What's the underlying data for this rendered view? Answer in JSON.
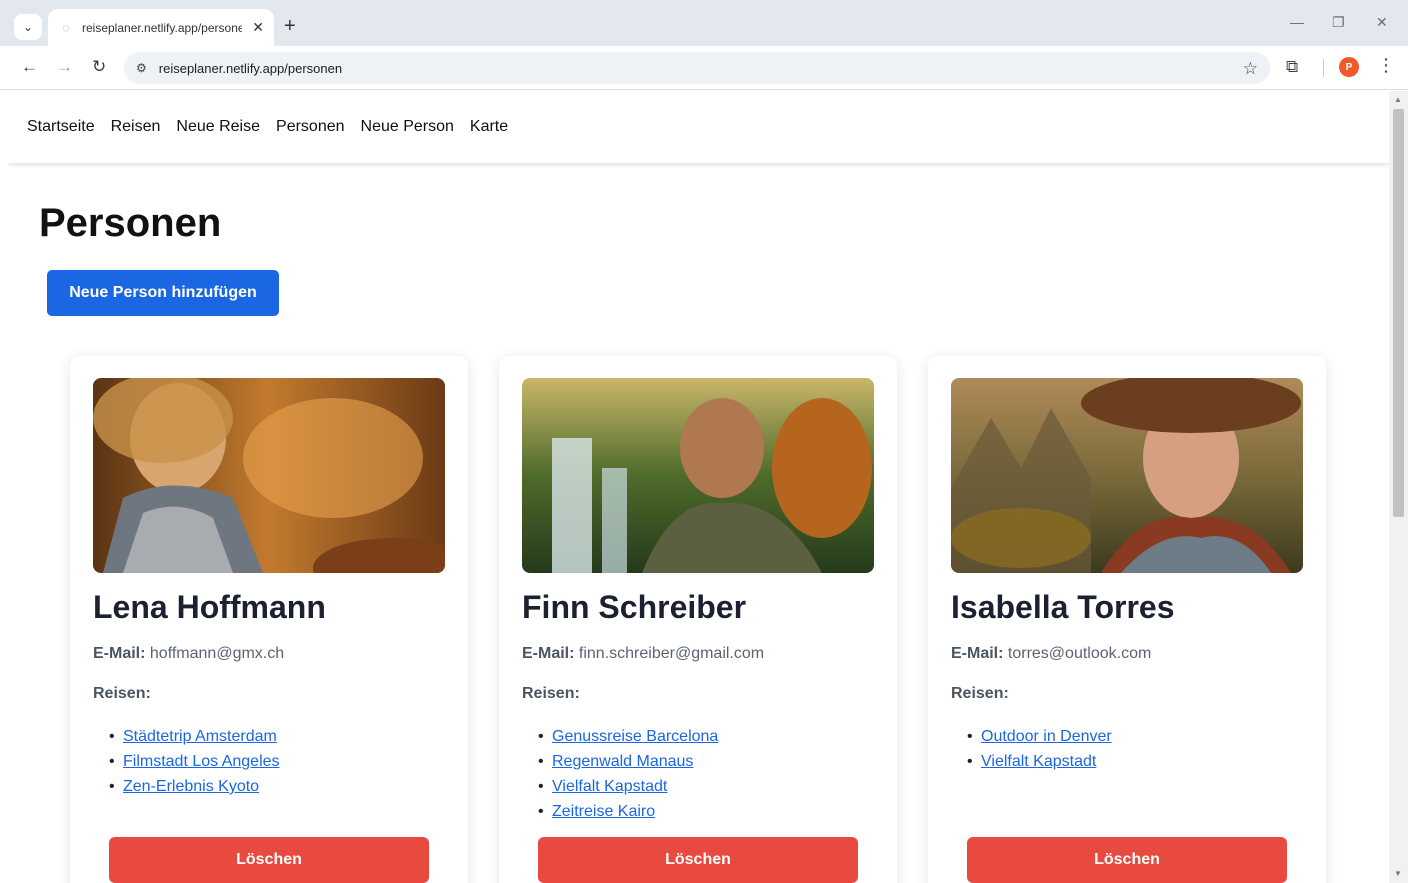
{
  "browser": {
    "tab_title": "reiseplaner.netlify.app/persone",
    "url": "reiseplaner.netlify.app/personen",
    "profile_initial": "P",
    "icons": {
      "tab_menu": "chevron-down-icon",
      "favicon": "globe-icon",
      "close": "close-icon",
      "new_tab": "plus-icon",
      "back": "back-arrow-icon",
      "forward": "forward-arrow-icon",
      "reload": "reload-icon",
      "site_info": "tune-icon",
      "bookmark": "star-icon",
      "extensions": "puzzle-icon",
      "menu": "kebab-menu-icon"
    }
  },
  "nav": {
    "items": [
      "Startseite",
      "Reisen",
      "Neue Reise",
      "Personen",
      "Neue Person",
      "Karte"
    ]
  },
  "page": {
    "title": "Personen",
    "add_button": "Neue Person hinzufügen"
  },
  "labels": {
    "email": "E-Mail:",
    "trips": "Reisen:",
    "delete": "Löschen"
  },
  "persons": [
    {
      "name": "Lena Hoffmann",
      "email": "hoffmann@gmx.ch",
      "trips": [
        "Städtetrip Amsterdam",
        "Filmstadt Los Angeles",
        "Zen-Erlebnis Kyoto"
      ]
    },
    {
      "name": "Finn Schreiber",
      "email": "finn.schreiber@gmail.com",
      "trips": [
        "Genussreise Barcelona",
        "Regenwald Manaus",
        "Vielfalt Kapstadt",
        "Zeitreise Kairo"
      ]
    },
    {
      "name": "Isabella Torres",
      "email": "torres@outlook.com",
      "trips": [
        "Outdoor in Denver",
        "Vielfalt Kapstadt"
      ]
    }
  ],
  "colors": {
    "primary_button": "#1a66e3",
    "danger_button": "#e84a3f",
    "link": "#1a66e3"
  }
}
